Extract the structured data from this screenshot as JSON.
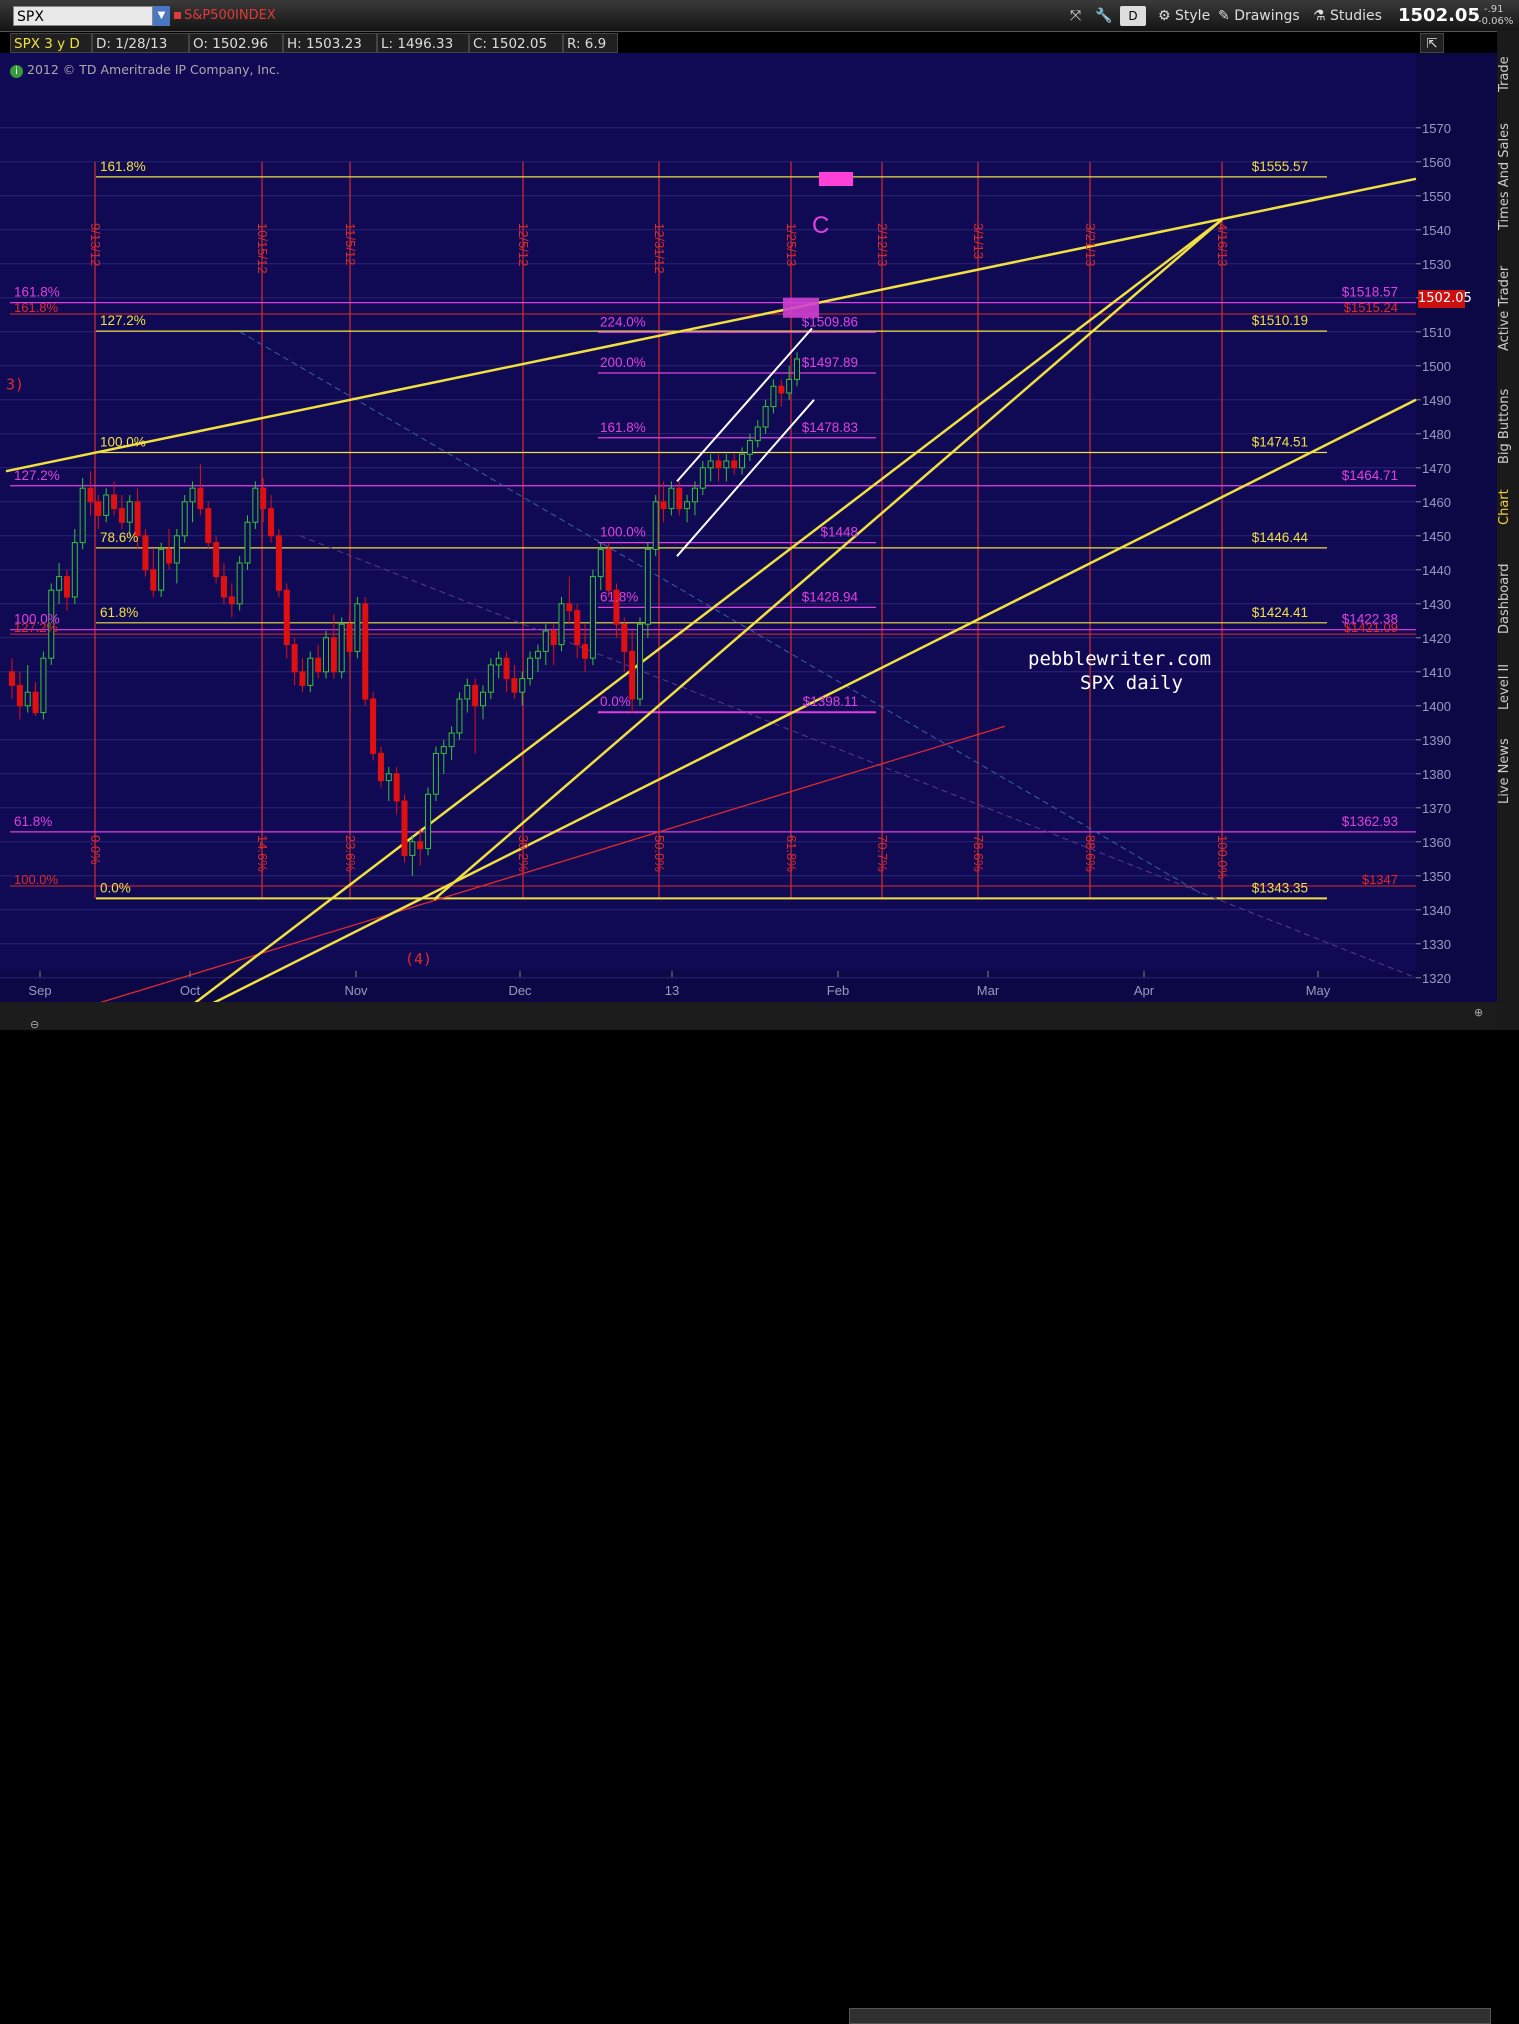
{
  "toolbar": {
    "symbol": "SPX",
    "description": "S&P500INDEX",
    "style_label": "Style",
    "drawings_label": "Drawings",
    "studies_label": "Studies",
    "d_label": "D",
    "last_price": "1502.05",
    "change": "-.91",
    "change_pct": "-0.06%"
  },
  "infobar": {
    "period": "SPX 3 y D",
    "date": "D: 1/28/13",
    "open": "O: 1502.96",
    "high": "H: 1503.23",
    "low": "L: 1496.33",
    "close": "C: 1502.05",
    "range": "R: 6.9"
  },
  "copyright": "2012 © TD Ameritrade IP Company, Inc.",
  "side_tabs": [
    "Trade",
    "Times And Sales",
    "Active Trader",
    "Big Buttons",
    "Chart",
    "Dashboard",
    "Level II",
    "Live News"
  ],
  "colors": {
    "plot_bg": "#100a55",
    "up": "#33c333",
    "down": "#e01010",
    "yellow": "#f0e040",
    "magenta": "#e040e0",
    "red": "#e02a2a",
    "white": "#ffffff"
  },
  "chart_data": {
    "type": "candlestick",
    "ylim": [
      1307,
      1582
    ],
    "yticks": [
      1320,
      1330,
      1340,
      1350,
      1360,
      1370,
      1380,
      1390,
      1400,
      1410,
      1420,
      1430,
      1440,
      1450,
      1460,
      1470,
      1480,
      1490,
      1500,
      1510,
      1520,
      1530,
      1540,
      1550,
      1560,
      1570
    ],
    "months": [
      "Sep",
      "Oct",
      "Nov",
      "Dec",
      "13",
      "Feb",
      "Mar",
      "Apr",
      "May"
    ],
    "current_price": "1502.05",
    "candles": [
      [
        1410,
        1414,
        1402,
        1406
      ],
      [
        1406,
        1410,
        1396,
        1400
      ],
      [
        1400,
        1412,
        1398,
        1404
      ],
      [
        1404,
        1407,
        1397,
        1398
      ],
      [
        1398,
        1416,
        1396,
        1414
      ],
      [
        1414,
        1436,
        1412,
        1434
      ],
      [
        1434,
        1442,
        1430,
        1438
      ],
      [
        1438,
        1440,
        1428,
        1432
      ],
      [
        1432,
        1452,
        1430,
        1448
      ],
      [
        1448,
        1467,
        1446,
        1464
      ],
      [
        1464,
        1469,
        1456,
        1460
      ],
      [
        1460,
        1462,
        1452,
        1456
      ],
      [
        1456,
        1464,
        1454,
        1462
      ],
      [
        1462,
        1466,
        1456,
        1458
      ],
      [
        1458,
        1462,
        1452,
        1454
      ],
      [
        1454,
        1462,
        1450,
        1460
      ],
      [
        1460,
        1464,
        1446,
        1450
      ],
      [
        1450,
        1452,
        1438,
        1440
      ],
      [
        1440,
        1446,
        1432,
        1434
      ],
      [
        1434,
        1448,
        1432,
        1446
      ],
      [
        1446,
        1452,
        1440,
        1442
      ],
      [
        1442,
        1452,
        1436,
        1450
      ],
      [
        1450,
        1462,
        1448,
        1460
      ],
      [
        1460,
        1466,
        1454,
        1464
      ],
      [
        1464,
        1471,
        1456,
        1458
      ],
      [
        1458,
        1460,
        1446,
        1448
      ],
      [
        1448,
        1450,
        1436,
        1438
      ],
      [
        1438,
        1442,
        1430,
        1432
      ],
      [
        1432,
        1436,
        1426,
        1430
      ],
      [
        1430,
        1444,
        1428,
        1442
      ],
      [
        1442,
        1456,
        1440,
        1454
      ],
      [
        1454,
        1466,
        1452,
        1464
      ],
      [
        1464,
        1467,
        1454,
        1458
      ],
      [
        1458,
        1462,
        1448,
        1450
      ],
      [
        1450,
        1452,
        1432,
        1434
      ],
      [
        1434,
        1436,
        1414,
        1418
      ],
      [
        1418,
        1420,
        1406,
        1410
      ],
      [
        1410,
        1414,
        1404,
        1406
      ],
      [
        1406,
        1416,
        1404,
        1414
      ],
      [
        1414,
        1418,
        1408,
        1410
      ],
      [
        1410,
        1422,
        1408,
        1420
      ],
      [
        1420,
        1427,
        1408,
        1410
      ],
      [
        1410,
        1426,
        1408,
        1424
      ],
      [
        1424,
        1428,
        1414,
        1416
      ],
      [
        1416,
        1432,
        1414,
        1430
      ],
      [
        1430,
        1432,
        1400,
        1402
      ],
      [
        1402,
        1404,
        1384,
        1386
      ],
      [
        1386,
        1388,
        1376,
        1378
      ],
      [
        1378,
        1382,
        1372,
        1380
      ],
      [
        1380,
        1382,
        1368,
        1372
      ],
      [
        1372,
        1374,
        1354,
        1356
      ],
      [
        1356,
        1362,
        1350,
        1360
      ],
      [
        1360,
        1364,
        1353,
        1358
      ],
      [
        1358,
        1376,
        1356,
        1374
      ],
      [
        1374,
        1388,
        1372,
        1386
      ],
      [
        1386,
        1390,
        1380,
        1388
      ],
      [
        1388,
        1394,
        1384,
        1392
      ],
      [
        1392,
        1404,
        1390,
        1402
      ],
      [
        1402,
        1408,
        1398,
        1406
      ],
      [
        1406,
        1408,
        1386,
        1400
      ],
      [
        1400,
        1406,
        1396,
        1404
      ],
      [
        1404,
        1414,
        1402,
        1412
      ],
      [
        1412,
        1416,
        1408,
        1414
      ],
      [
        1414,
        1416,
        1404,
        1408
      ],
      [
        1408,
        1412,
        1402,
        1404
      ],
      [
        1404,
        1410,
        1400,
        1408
      ],
      [
        1408,
        1416,
        1406,
        1414
      ],
      [
        1414,
        1418,
        1410,
        1416
      ],
      [
        1416,
        1424,
        1412,
        1422
      ],
      [
        1422,
        1424,
        1412,
        1418
      ],
      [
        1418,
        1432,
        1416,
        1430
      ],
      [
        1430,
        1438,
        1424,
        1428
      ],
      [
        1428,
        1430,
        1414,
        1418
      ],
      [
        1418,
        1424,
        1410,
        1414
      ],
      [
        1414,
        1440,
        1412,
        1438
      ],
      [
        1438,
        1448,
        1434,
        1446
      ],
      [
        1446,
        1448,
        1432,
        1434
      ],
      [
        1434,
        1436,
        1420,
        1424
      ],
      [
        1424,
        1426,
        1410,
        1416
      ],
      [
        1416,
        1422,
        1398,
        1402
      ],
      [
        1402,
        1426,
        1400,
        1424
      ],
      [
        1424,
        1448,
        1420,
        1446
      ],
      [
        1446,
        1462,
        1444,
        1460
      ],
      [
        1460,
        1466,
        1454,
        1458
      ],
      [
        1458,
        1466,
        1456,
        1464
      ],
      [
        1464,
        1466,
        1456,
        1458
      ],
      [
        1458,
        1462,
        1454,
        1460
      ],
      [
        1460,
        1466,
        1456,
        1464
      ],
      [
        1464,
        1472,
        1462,
        1470
      ],
      [
        1470,
        1474,
        1466,
        1472
      ],
      [
        1472,
        1474,
        1466,
        1470
      ],
      [
        1470,
        1474,
        1466,
        1472
      ],
      [
        1472,
        1474,
        1468,
        1470
      ],
      [
        1470,
        1476,
        1468,
        1474
      ],
      [
        1474,
        1480,
        1472,
        1478
      ],
      [
        1478,
        1484,
        1476,
        1482
      ],
      [
        1482,
        1490,
        1480,
        1488
      ],
      [
        1488,
        1496,
        1486,
        1494
      ],
      [
        1494,
        1496,
        1488,
        1492
      ],
      [
        1492,
        1500,
        1490,
        1496
      ],
      [
        1496,
        1504,
        1494,
        1502
      ]
    ],
    "fib_yellow": [
      {
        "label": "161.8%",
        "value": "$1555.57",
        "y": 1555.57
      },
      {
        "label": "127.2%",
        "value": "$1510.19",
        "y": 1510.19
      },
      {
        "label": "100.0%",
        "value": "$1474.51",
        "y": 1474.51
      },
      {
        "label": "78.6%",
        "value": "$1446.44",
        "y": 1446.44
      },
      {
        "label": "61.8%",
        "value": "$1424.41",
        "y": 1424.41
      },
      {
        "label": "0.0%",
        "value": "$1343.35",
        "y": 1343.35
      }
    ],
    "fib_magenta_right": [
      {
        "label": "161.8%",
        "value": "$1518.57",
        "y": 1518.57
      },
      {
        "label": "127.2%",
        "value": "$1464.71",
        "y": 1464.71
      },
      {
        "label": "100.0%",
        "value": "$1422.38",
        "y": 1422.38
      },
      {
        "label": "61.8%",
        "value": "$1362.93",
        "y": 1362.93
      }
    ],
    "fib_magenta_mid": [
      {
        "label": "224.0%",
        "value": "$1509.86",
        "y": 1509.86
      },
      {
        "label": "200.0%",
        "value": "$1497.89",
        "y": 1497.89
      },
      {
        "label": "161.8%",
        "value": "$1478.83",
        "y": 1478.83
      },
      {
        "label": "100.0%",
        "value": "$1448",
        "y": 1448
      },
      {
        "label": "61.8%",
        "value": "$1428.94",
        "y": 1428.94
      },
      {
        "label": "0.0%",
        "value": "$1398.11",
        "y": 1398.11
      }
    ],
    "red_levels": [
      {
        "label": "161.8%",
        "value": "$1515.24",
        "y": 1515.24
      },
      {
        "label": "127.2%",
        "value": "$1421.09",
        "y": 1421.09
      },
      {
        "label": "100.0%",
        "value": "$1347",
        "y": 1347
      }
    ],
    "time_dates": [
      "9/13/12",
      "10/15/12",
      "11/5/12",
      "12/5/12",
      "12/31/12",
      "1/25/13",
      "2/12/13",
      "3/1/13",
      "3/21/13",
      "4/16/13"
    ],
    "time_pcts": [
      "0.0%",
      "14.6%",
      "23.6%",
      "38.2%",
      "50.0%",
      "61.8%",
      "70.7%",
      "78.6%",
      "88.6%",
      "100.0%"
    ],
    "wave_labels": [
      "C",
      "(4)",
      "3)"
    ],
    "annotation": [
      "pebblewriter.com",
      "SPX daily"
    ]
  }
}
